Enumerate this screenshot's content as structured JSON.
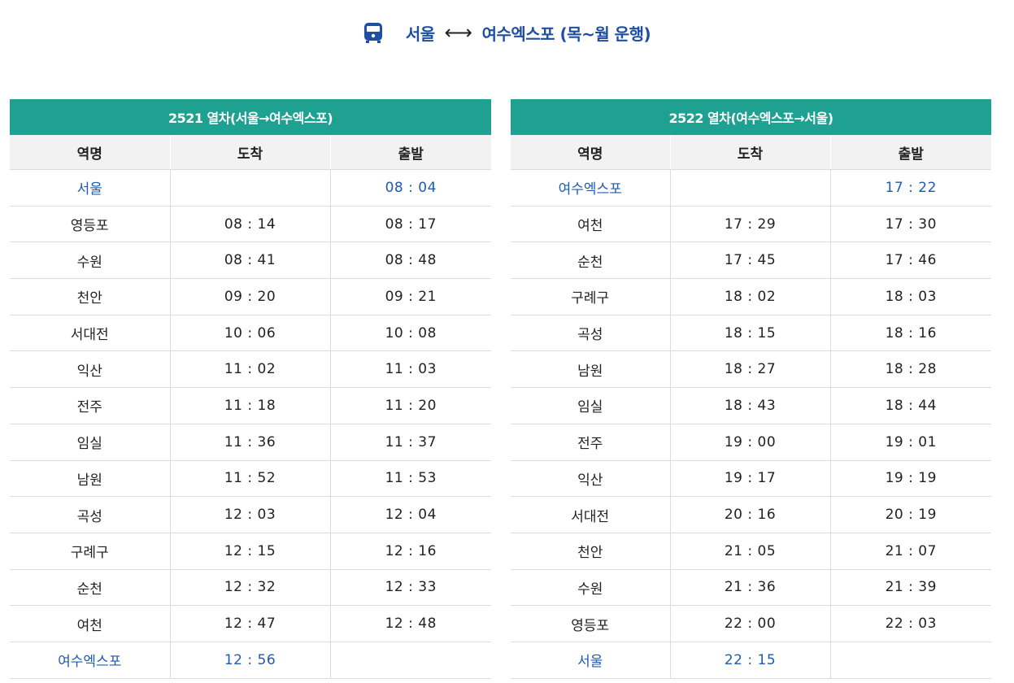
{
  "header": {
    "from": "서울",
    "arrow": "⟷",
    "to": "여수엑스포 (목~월 운행)",
    "icon": "train-icon",
    "accent": "#1f4fa3"
  },
  "theme": {
    "header_bg": "#1fa192",
    "terminal_text": "#1f5bb0"
  },
  "tables": [
    {
      "caption": "2521 열차(서울→여수엑스포)",
      "columns": [
        "역명",
        "도착",
        "출발"
      ],
      "rows": [
        [
          "서울",
          "",
          "08 : 04"
        ],
        [
          "영등포",
          "08 : 14",
          "08 : 17"
        ],
        [
          "수원",
          "08 : 41",
          "08 : 48"
        ],
        [
          "천안",
          "09 : 20",
          "09 : 21"
        ],
        [
          "서대전",
          "10 : 06",
          "10 : 08"
        ],
        [
          "익산",
          "11 : 02",
          "11 : 03"
        ],
        [
          "전주",
          "11 : 18",
          "11 : 20"
        ],
        [
          "임실",
          "11 : 36",
          "11 : 37"
        ],
        [
          "남원",
          "11 : 52",
          "11 : 53"
        ],
        [
          "곡성",
          "12 : 03",
          "12 : 04"
        ],
        [
          "구례구",
          "12 : 15",
          "12 : 16"
        ],
        [
          "순천",
          "12 : 32",
          "12 : 33"
        ],
        [
          "여천",
          "12 : 47",
          "12 : 48"
        ],
        [
          "여수엑스포",
          "12 : 56",
          ""
        ]
      ]
    },
    {
      "caption": "2522 열차(여수엑스포→서울)",
      "columns": [
        "역명",
        "도착",
        "출발"
      ],
      "rows": [
        [
          "여수엑스포",
          "",
          "17 : 22"
        ],
        [
          "여천",
          "17 : 29",
          "17 : 30"
        ],
        [
          "순천",
          "17 : 45",
          "17 : 46"
        ],
        [
          "구례구",
          "18 : 02",
          "18 : 03"
        ],
        [
          "곡성",
          "18 : 15",
          "18 : 16"
        ],
        [
          "남원",
          "18 : 27",
          "18 : 28"
        ],
        [
          "임실",
          "18 : 43",
          "18 : 44"
        ],
        [
          "전주",
          "19 : 00",
          "19 : 01"
        ],
        [
          "익산",
          "19 : 17",
          "19 : 19"
        ],
        [
          "서대전",
          "20 : 16",
          "20 : 19"
        ],
        [
          "천안",
          "21 : 05",
          "21 : 07"
        ],
        [
          "수원",
          "21 : 36",
          "21 : 39"
        ],
        [
          "영등포",
          "22 : 00",
          "22 : 03"
        ],
        [
          "서울",
          "22 : 15",
          ""
        ]
      ]
    }
  ]
}
